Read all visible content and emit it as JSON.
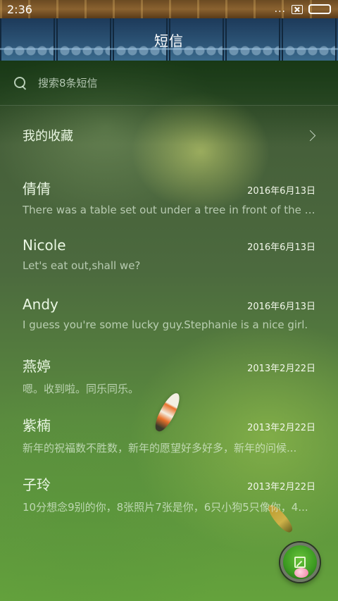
{
  "status_bar": {
    "time": "2:36",
    "dots": "...",
    "battery_color": "#4cd33b"
  },
  "header": {
    "title": "短信"
  },
  "search": {
    "placeholder": "搜索8条短信"
  },
  "favorites": {
    "label": "我的收藏"
  },
  "threads": [
    {
      "name": "倩倩",
      "date": "2016年6月13日",
      "snippet": "There was a table set out under a tree in front of the ho..."
    },
    {
      "name": "Nicole",
      "date": "2016年6月13日",
      "snippet": "Let's eat out,shall we?"
    },
    {
      "name": "Andy",
      "date": "2016年6月13日",
      "snippet": "I guess you're some lucky guy.Stephanie is a nice girl."
    },
    {
      "name": "燕婷",
      "date": "2013年2月22日",
      "snippet": "嗯。收到啦。同乐同乐。"
    },
    {
      "name": "紫楠",
      "date": "2013年2月22日",
      "snippet": "新年的祝福数不胜数，新年的愿望好多好多，新年的问候..."
    },
    {
      "name": "子玲",
      "date": "2013年2月22日",
      "snippet": "10分想念9别的你，8张照片7张是你，6只小狗5只像你，4..."
    }
  ],
  "icons": {
    "search": "search-icon",
    "chevron": "chevron-right-icon",
    "compose": "compose-icon",
    "sim": "sim-card-icon",
    "battery": "battery-icon"
  },
  "colors": {
    "accent": "#3b9a21",
    "title_bar": "#2c5476"
  }
}
